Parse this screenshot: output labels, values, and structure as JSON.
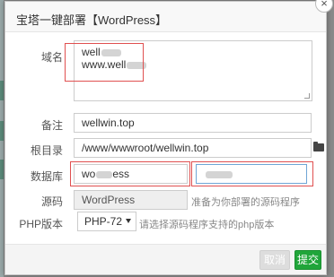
{
  "dialog": {
    "title": "宝塔一键部署【WordPress】",
    "close_icon": "close-icon"
  },
  "form": {
    "domain": {
      "label": "域名",
      "line1": "well",
      "line2": "www.well"
    },
    "remark": {
      "label": "备注",
      "value": "wellwin.top"
    },
    "root": {
      "label": "根目录",
      "value": "/www/wwwroot/wellwin.top",
      "icon": "folder-icon"
    },
    "database": {
      "label": "数据库",
      "user_value": "wo",
      "user_value_tail": "ess",
      "password_value": ""
    },
    "source": {
      "label": "源码",
      "value": "WordPress",
      "hint": "准备为你部署的源码程序"
    },
    "php": {
      "label": "PHP版本",
      "selected": "PHP-72",
      "hint": "请选择源码程序支持的php版本"
    }
  },
  "footer": {
    "cancel_label": "取消",
    "submit_label": "提交"
  },
  "colors": {
    "accent": "#20a53a",
    "highlight": "#e05050",
    "focus": "#6fa6d6"
  }
}
